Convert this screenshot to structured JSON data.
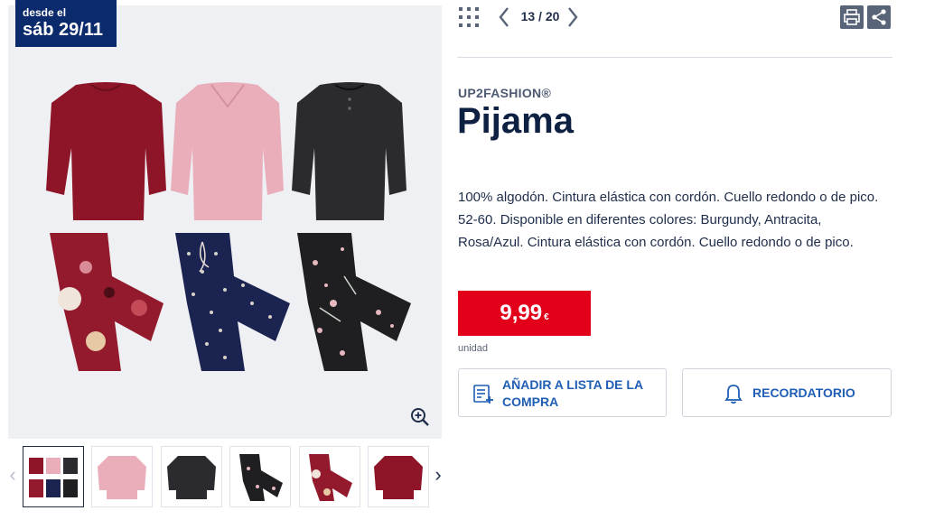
{
  "badge": {
    "line1": "desde el",
    "line2": "sáb 29/11"
  },
  "pager": {
    "text": "13 / 20"
  },
  "product": {
    "brand": "UP2FASHION®",
    "title": "Pijama",
    "description": "100% algodón. Cintura elástica con cordón. Cuello redondo o de pico. 52-60. Disponible en diferentes colores: Burgundy, Antracita, Rosa/Azul. Cintura elástica con cordón. Cuello redondo o de pico.",
    "price": "9,99",
    "currency": "€",
    "unit": "unidad"
  },
  "buttons": {
    "add_to_list": "AÑADIR A LISTA DE LA COMPRA",
    "reminder": "RECORDATORIO"
  },
  "icons": {
    "grid": "grid-icon",
    "prev": "chevron-left-icon",
    "next": "chevron-right-icon",
    "print": "print-icon",
    "share": "share-icon",
    "zoom": "zoom-in-icon",
    "list": "list-add-icon",
    "bell": "bell-icon"
  },
  "colors": {
    "brand_blue": "#0b2a6b",
    "price_red": "#e2001a",
    "link_blue": "#1f5eb5",
    "burgundy": "#8e1427",
    "pink": "#e9aab8",
    "anthracite": "#2a2a2e",
    "navy": "#1b2350"
  }
}
